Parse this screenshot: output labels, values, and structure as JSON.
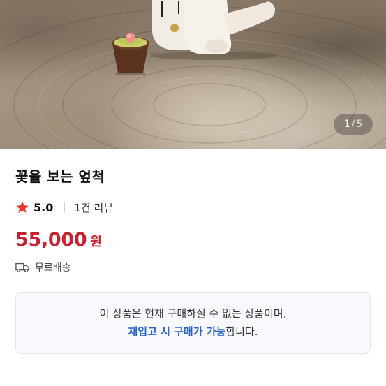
{
  "product": {
    "title": "꽃을 보는 엎척",
    "rating": "5.0",
    "review_link": "1건 리뷰",
    "price": "55,000",
    "price_unit": "원",
    "shipping": "무료배송"
  },
  "gallery": {
    "current": "1",
    "separator": "/",
    "total": "5"
  },
  "notice": {
    "line1": "이 상품은 현재 구매하실 수 없는 상품이며,",
    "line2_highlight": "재입고 시 구매가 가능",
    "line2_suffix": "합니다."
  },
  "icons": {
    "rating": "star-icon",
    "shipping": "truck-icon"
  },
  "colors": {
    "price": "#c62330",
    "star": "#e53935",
    "notice_highlight": "#2a63c7",
    "notice_background": "#f7f9fc"
  }
}
